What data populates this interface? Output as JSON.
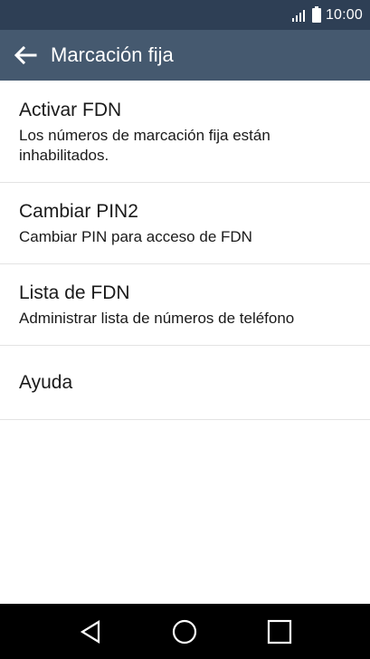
{
  "status_bar": {
    "time": "10:00",
    "icons": [
      "signal-icon",
      "battery-icon"
    ]
  },
  "app_bar": {
    "title": "Marcación fija",
    "back_icon": "arrow-left-icon"
  },
  "settings": [
    {
      "title": "Activar FDN",
      "subtitle": "Los números de marcación fija están inhabilitados."
    },
    {
      "title": "Cambiar PIN2",
      "subtitle": "Cambiar PIN para acceso de FDN"
    },
    {
      "title": "Lista de FDN",
      "subtitle": "Administrar lista de números de teléfono"
    },
    {
      "title": "Ayuda"
    }
  ],
  "nav_bar": {
    "buttons": [
      "back-triangle-icon",
      "home-circle-icon",
      "recents-square-icon"
    ]
  },
  "colors": {
    "status_bar": "#2e3f55",
    "app_bar": "#45596f",
    "nav_bar": "#000000",
    "divider": "#e3e3e3"
  }
}
